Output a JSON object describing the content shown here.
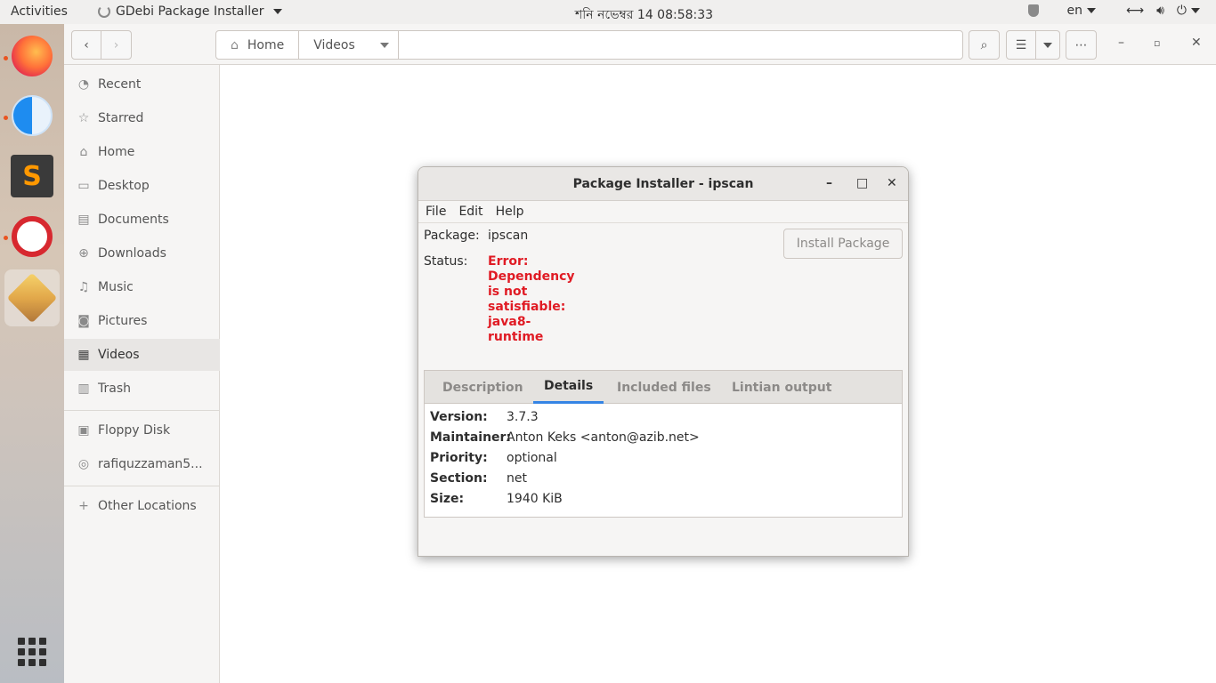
{
  "topbar": {
    "activities": "Activities",
    "app_name": "GDebi Package Installer",
    "clock": "শনি নভেম্বর 14  08:58:33",
    "keyboard_layout": "en"
  },
  "files": {
    "path_home": "Home",
    "path_current": "Videos",
    "sidebar": [
      {
        "label": "Recent",
        "icon": "clock"
      },
      {
        "label": "Starred",
        "icon": "star"
      },
      {
        "label": "Home",
        "icon": "home"
      },
      {
        "label": "Desktop",
        "icon": "desktop"
      },
      {
        "label": "Documents",
        "icon": "document"
      },
      {
        "label": "Downloads",
        "icon": "download"
      },
      {
        "label": "Music",
        "icon": "music"
      },
      {
        "label": "Pictures",
        "icon": "camera"
      },
      {
        "label": "Videos",
        "icon": "film"
      },
      {
        "label": "Trash",
        "icon": "trash"
      },
      {
        "label": "Floppy Disk",
        "icon": "floppy"
      },
      {
        "label": "rafiquzzaman5...",
        "icon": "network"
      },
      {
        "label": "Other Locations",
        "icon": "plus"
      }
    ]
  },
  "dialog": {
    "title": "Package Installer - ipscan",
    "menu": [
      "File",
      "Edit",
      "Help"
    ],
    "package_label": "Package:",
    "package_value": "ipscan",
    "status_label": "Status:",
    "status_lines": [
      "Error:",
      "Dependency",
      "is not",
      "satisfiable:",
      "java8-",
      "runtime"
    ],
    "install_button": "Install Package",
    "tabs": [
      "Description",
      "Details",
      "Included files",
      "Lintian output"
    ],
    "active_tab": "Details",
    "details": [
      {
        "key": "Version:",
        "value": "3.7.3"
      },
      {
        "key": "Maintainer:",
        "value": "Anton Keks <anton@azib.net>"
      },
      {
        "key": "Priority:",
        "value": "optional"
      },
      {
        "key": "Section:",
        "value": "net"
      },
      {
        "key": "Size:",
        "value": "1940 KiB"
      }
    ]
  },
  "colors": {
    "error_red": "#e01b24",
    "accent_blue": "#3584e4",
    "ubuntu_orange": "#e95420"
  }
}
